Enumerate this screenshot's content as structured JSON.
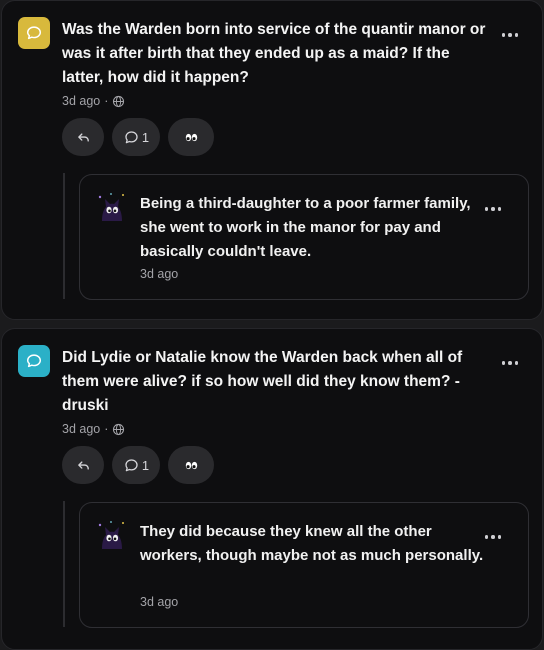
{
  "posts": [
    {
      "question": "Was the Warden born into service of the quantir manor or was it after birth that they ended up as a maid? If the latter, how did it happen?",
      "time": "3d ago",
      "separator": "·",
      "comment_count": "1",
      "avatar_color": "#d8b93c",
      "reply": {
        "text": "Being a third-daughter to a poor farmer family, she went to work in the manor for pay and basically couldn't leave.",
        "time": "3d ago"
      }
    },
    {
      "question": "Did Lydie or Natalie know the Warden back when all of them were alive? if so how well did they know them? -druski",
      "time": "3d ago",
      "separator": "·",
      "comment_count": "1",
      "avatar_color": "#2bb0c7",
      "reply": {
        "text": "They did because they knew all the other workers, though maybe not as much personally.",
        "time": "3d ago"
      }
    }
  ],
  "icons": {
    "question_avatar": "chat-bubble-icon",
    "visibility": "globe-icon",
    "reply_action": "reply-arrow-icon",
    "comment_action": "comment-bubble-icon",
    "reaction_action": "eyes-icon",
    "menu": "more-horizontal-icon",
    "responder_avatar": "cat-character-avatar"
  }
}
